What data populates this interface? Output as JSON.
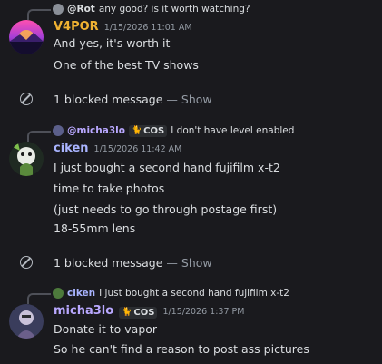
{
  "messages": [
    {
      "reply": {
        "author": "@Rot",
        "text": "any good? is it worth watching?"
      },
      "author": "V4POR",
      "author_color": "#f0b232",
      "timestamp": "1/15/2026 11:01 AM",
      "lines": [
        "And yes, it's worth it",
        "One of the best TV shows"
      ]
    },
    {
      "reply": {
        "author": "@micha3lo",
        "tag": "COS",
        "text": "I don't have level enabled"
      },
      "author": "ciken",
      "author_color": "#a9b4ff",
      "timestamp": "1/15/2026 11:42 AM",
      "lines": [
        "I just bought a second hand fujifilm x-t2",
        "time to take photos",
        "(just needs to go through postage first)",
        "18-55mm lens"
      ]
    },
    {
      "reply": {
        "author": "ciken",
        "text": "I just bought a second hand fujifilm x-t2"
      },
      "author": "micha3lo",
      "author_color": "#b9a8ff",
      "tag": "COS",
      "timestamp": "1/15/2026 1:37 PM",
      "lines": [
        "Donate it to vapor",
        "So he can't find a reason to post ass pictures"
      ]
    }
  ],
  "blocked": [
    {
      "text": "1 blocked message",
      "separator": " — ",
      "action": "Show"
    },
    {
      "text": "1 blocked message",
      "separator": " — ",
      "action": "Show"
    }
  ],
  "icons": {
    "blocked": "blocked-circle-icon",
    "tag_badge": "cat-icon"
  }
}
